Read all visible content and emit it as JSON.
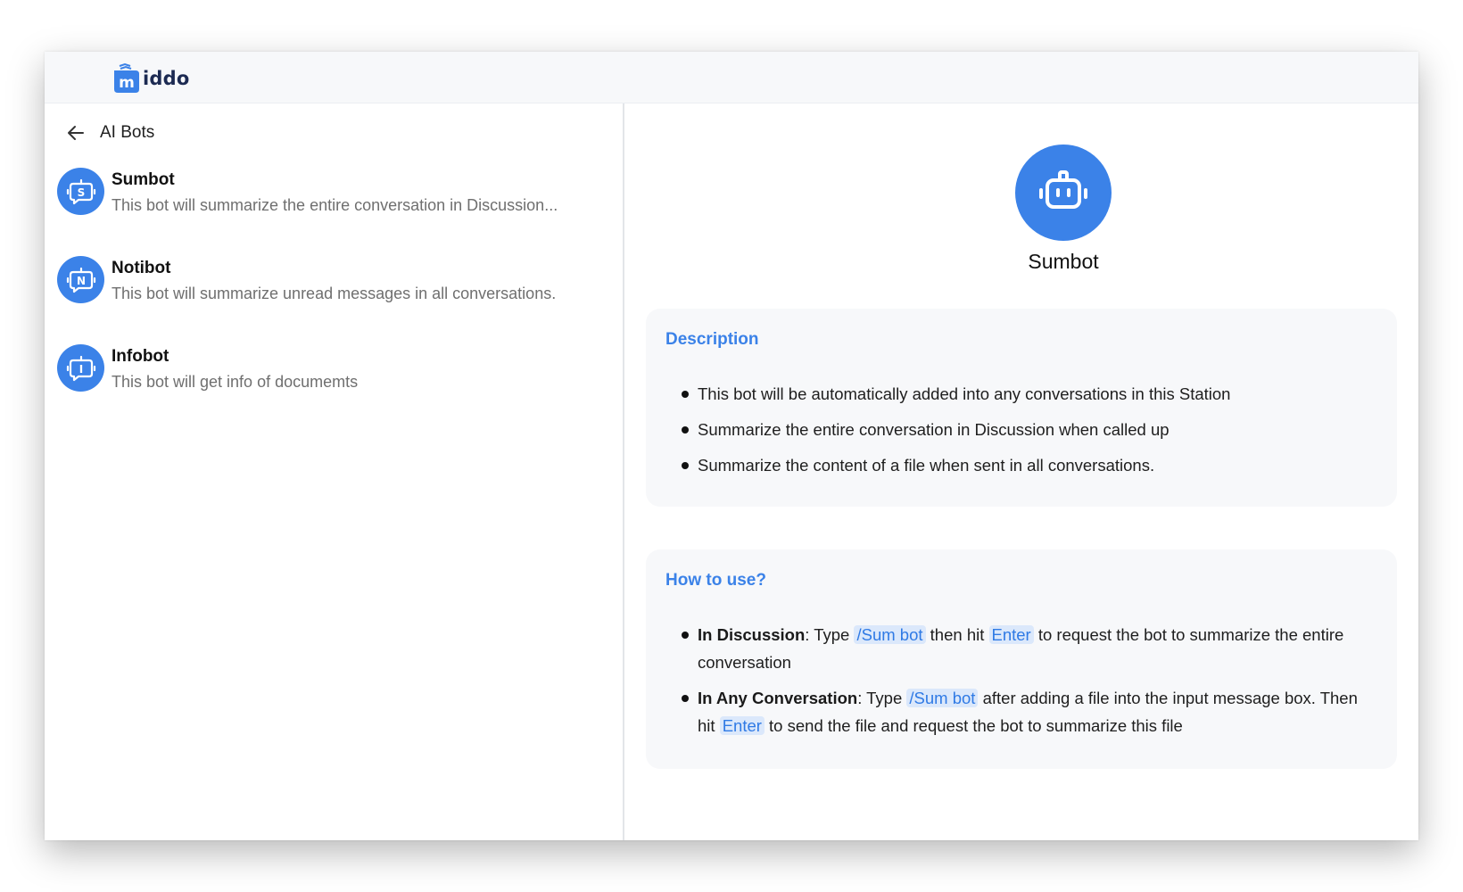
{
  "app": {
    "logo_text": "iddo",
    "logo_letter": "m"
  },
  "left_panel": {
    "title": "AI Bots",
    "bots": [
      {
        "name": "Sumbot",
        "description": "This bot will summarize the entire conversation in Discussion...",
        "letter": "S"
      },
      {
        "name": "Notibot",
        "description": "This bot will summarize unread messages in all conversations.",
        "letter": "N"
      },
      {
        "name": "Infobot",
        "description": "This bot will get info of documemts",
        "letter": "I"
      }
    ]
  },
  "detail": {
    "name": "Sumbot",
    "description": {
      "title": "Description",
      "items": [
        "This bot will be automatically added into any conversations in this Station",
        "Summarize the entire conversation in Discussion when called up",
        "Summarize the content of a file when sent in all conversations."
      ]
    },
    "how_to_use": {
      "title": "How to use?",
      "item1": {
        "label": "In Discussion",
        "sep": ": Type ",
        "command": "/Sum bot",
        "mid": " then hit ",
        "key": "Enter",
        "rest": " to request the bot to summarize the entire conversation"
      },
      "item2": {
        "label": "In Any Conversation",
        "sep": ": Type ",
        "command": "/Sum bot",
        "mid": " after adding a file into the input message box. Then hit ",
        "key": "Enter",
        "rest": " to send the file and request the bot to summarize this file"
      }
    }
  },
  "colors": {
    "accent": "#3b82e8",
    "chip_bg": "#dbe8fb",
    "card_bg": "#f7f8fa",
    "muted_text": "#6f6f6f"
  },
  "icons": {
    "back": "arrow-left-icon",
    "bot_avatar": "robot-icon",
    "logo": "middo-logo-icon"
  }
}
